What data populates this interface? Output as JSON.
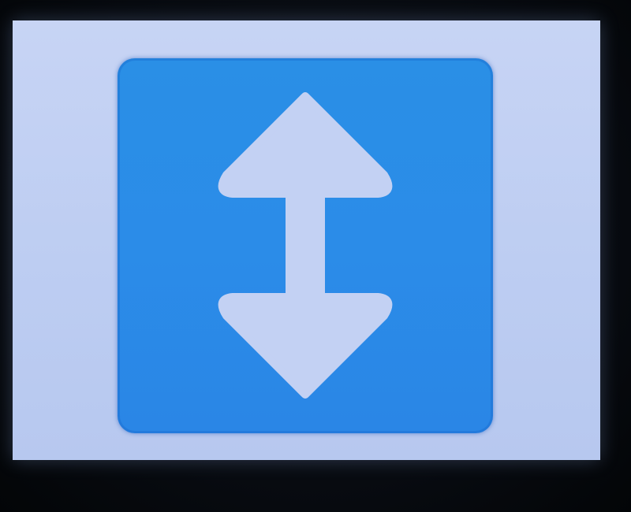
{
  "icon": {
    "name": "up-down-arrow-icon",
    "tile_color": "#2a8ce8",
    "arrow_color": "#c3d1f3",
    "screen_color": "#c2d0f3"
  }
}
